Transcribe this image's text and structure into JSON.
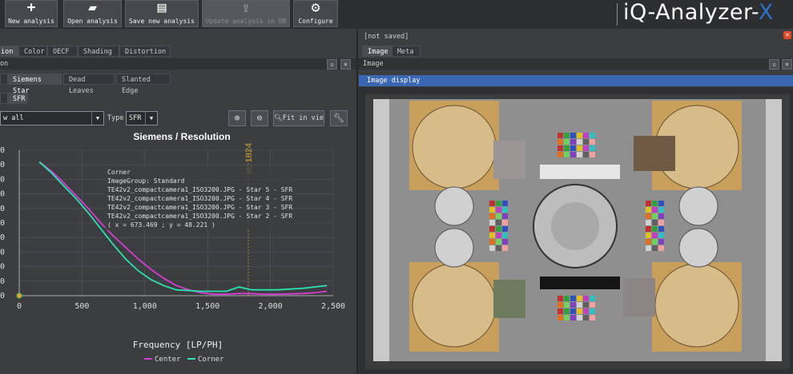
{
  "toolbar": {
    "new_analysis": "New analysis",
    "open_analysis": "Open analysis",
    "save_new_analysis": "Save new analysis",
    "update_analysis": "Update analysis in DB",
    "configure": "Configure"
  },
  "brand": {
    "name": "iQ-Analyzer-",
    "suffix": "X",
    "accent": "#2f6fc8"
  },
  "left": {
    "main_tabs": [
      "ion",
      "Color",
      "OECF",
      "Shading",
      "Distortion"
    ],
    "panel_title": "on",
    "sub_tabs": [
      "Siemens Star",
      "Dead Leaves",
      "Slanted Edge"
    ],
    "sub_sub_tab": "SFR",
    "view_select": "w all",
    "type_label": "Type",
    "type_value": "SFR",
    "fit_label": "Fit in vie"
  },
  "right": {
    "status": "[not saved]",
    "tabs": [
      "Image",
      "Meta"
    ],
    "panel_title": "Image",
    "display_title": "Image display"
  },
  "tooltip": {
    "lines": [
      "Corner",
      "ImageGroup: Standard",
      "TE42v2_compactcamera1_ISO3200.JPG - Star 5 - SFR",
      "TE42v2_compactcamera1_ISO3200.JPG - Star 4 - SFR",
      "TE42v2_compactcamera1_ISO3200.JPG - Star 3 - SFR",
      "TE42v2_compactcamera1_ISO3200.JPG - Star 2 - SFR",
      "( x = 673.469 ; y = 48.221 )"
    ]
  },
  "chart_data": {
    "type": "line",
    "title": "Siemens / Resolution",
    "xlabel": "Frequency [LP/PH]",
    "ylabel": "",
    "xlim": [
      0,
      2500
    ],
    "x_ticks": [
      "0",
      "500",
      "1,000",
      "1,500",
      "2,000",
      "2,500"
    ],
    "y_tick_labels": [
      "0",
      "0",
      "0",
      "0",
      "0",
      "0",
      "0",
      "0",
      "0",
      "0",
      "0"
    ],
    "marker_label": "st: 1824",
    "marker_x": 1824,
    "grid": true,
    "legend_position": "bottom",
    "series": [
      {
        "name": "Center",
        "color": "#d43fd2",
        "x": [
          160,
          250,
          350,
          450,
          550,
          650,
          750,
          850,
          950,
          1050,
          1150,
          1250,
          1350,
          1450,
          1550,
          1650,
          1750,
          1850,
          1950,
          2050,
          2150,
          2250,
          2350,
          2450
        ],
        "y": [
          0.92,
          0.86,
          0.78,
          0.69,
          0.6,
          0.5,
          0.41,
          0.33,
          0.25,
          0.18,
          0.12,
          0.07,
          0.04,
          0.02,
          0.01,
          0.01,
          0.015,
          0.015,
          0.01,
          0.01,
          0.012,
          0.015,
          0.02,
          0.03
        ]
      },
      {
        "name": "Corner",
        "color": "#2fe0b2",
        "x": [
          160,
          250,
          350,
          450,
          550,
          650,
          750,
          850,
          950,
          1050,
          1150,
          1250,
          1350,
          1450,
          1550,
          1650,
          1750,
          1850,
          1950,
          2050,
          2150,
          2250,
          2350,
          2450
        ],
        "y": [
          0.92,
          0.85,
          0.76,
          0.67,
          0.57,
          0.46,
          0.35,
          0.25,
          0.17,
          0.11,
          0.07,
          0.04,
          0.035,
          0.03,
          0.03,
          0.03,
          0.06,
          0.04,
          0.04,
          0.04,
          0.045,
          0.05,
          0.06,
          0.07
        ]
      }
    ]
  }
}
